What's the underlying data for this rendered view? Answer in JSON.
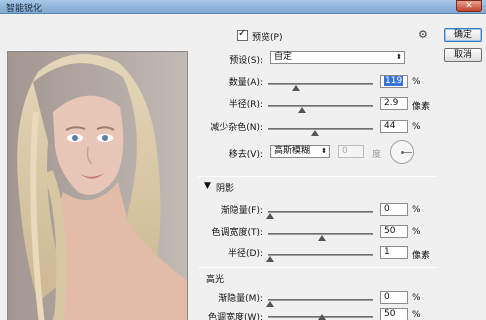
{
  "window": {
    "title": "智能锐化",
    "close_label": "✕"
  },
  "preview_checkbox": {
    "label": "预览(P)",
    "checked": true
  },
  "settings_icon": "gear-icon",
  "preset": {
    "label": "预设(S):",
    "value": "自定"
  },
  "amount": {
    "label": "数量(A):",
    "value": "119",
    "unit": "%",
    "level": 0.34
  },
  "radius": {
    "label": "半径(R):",
    "value": "2.9",
    "unit": "像素",
    "level": 0.3
  },
  "reduce_noise": {
    "label": "减少杂色(N):",
    "value": "44",
    "unit": "%",
    "level": 0.44
  },
  "remove": {
    "label": "移去(V):",
    "value": "高斯模糊",
    "angle_value": "0",
    "angle_unit": "度"
  },
  "shadows": {
    "section_title": "阴影",
    "fade": {
      "label": "渐隐量(F):",
      "value": "0",
      "unit": "%",
      "level": 0.0
    },
    "tonal_width": {
      "label": "色调宽度(T):",
      "value": "50",
      "unit": "%",
      "level": 0.5
    },
    "radius": {
      "label": "半径(D):",
      "value": "1",
      "unit": "像素",
      "level": 0.0
    }
  },
  "highlights": {
    "section_title": "高光",
    "fade": {
      "label": "渐隐量(M):",
      "value": "0",
      "unit": "%",
      "level": 0.0
    },
    "tonal_width": {
      "label": "色调宽度(W):",
      "value": "50",
      "unit": "%",
      "level": 0.5
    }
  },
  "buttons": {
    "ok": "确定",
    "cancel": "取消"
  }
}
